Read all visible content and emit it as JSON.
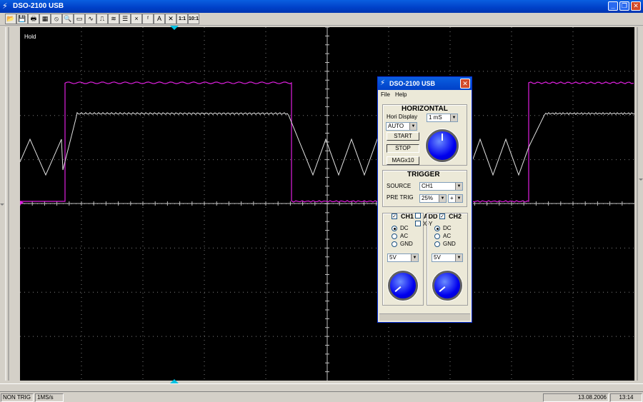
{
  "window": {
    "title": "DSO-2100 USB"
  },
  "toolbar": {
    "buttons": [
      {
        "icon": "open-folder-icon",
        "glyph": "📂"
      },
      {
        "icon": "save-icon",
        "glyph": "💾"
      },
      {
        "icon": "print-icon",
        "glyph": "🖶"
      },
      {
        "icon": "print-preview-icon",
        "glyph": "▦"
      },
      {
        "icon": "no-entry-icon",
        "glyph": "⦸"
      },
      {
        "icon": "zoom-icon",
        "glyph": "🔍"
      },
      {
        "icon": "grid-icon",
        "glyph": "▭"
      },
      {
        "icon": "wave-icon",
        "glyph": "∿"
      },
      {
        "icon": "wave-step-icon",
        "glyph": "⎍"
      },
      {
        "icon": "multi-wave-icon",
        "glyph": "≋"
      },
      {
        "icon": "lines-icon",
        "glyph": "☰"
      },
      {
        "icon": "cross-icon",
        "glyph": "×"
      },
      {
        "icon": "fft-icon",
        "glyph": "ᶠ"
      },
      {
        "icon": "cursor-a-icon",
        "glyph": "A"
      },
      {
        "icon": "close-cursor-icon",
        "glyph": "✕"
      },
      {
        "icon": "ratio-1-1-icon",
        "glyph": "1:1"
      },
      {
        "icon": "ratio-10-1-icon",
        "glyph": "10:1"
      }
    ]
  },
  "scope": {
    "hold_label": "Hold",
    "colors": {
      "ch1": "#e0e0e0",
      "ch2": "#e020e0",
      "grid": "#808080"
    }
  },
  "status": {
    "trigger": "NON TRIG",
    "rate": "1MS/s",
    "date": "13.08.2006",
    "time": "13:14"
  },
  "dialog": {
    "title": "DSO-2100 USB",
    "menu": {
      "file": "File",
      "help": "Help"
    },
    "horizontal": {
      "heading": "HORIZONTAL",
      "hori_display_label": "Hori Display",
      "time_base": "1 mS",
      "mode": "AUTO",
      "start": "START",
      "stop": "STOP",
      "mag": "MAGx10"
    },
    "trigger": {
      "heading": "TRIGGER",
      "source_label": "SOURCE",
      "source": "CH1",
      "pretrig_label": "PRE TRIG",
      "pretrig": "25%",
      "slope": "+"
    },
    "ch1": {
      "label": "CH1",
      "dc": "DC",
      "ac": "AC",
      "gnd": "GND",
      "volts": "5V"
    },
    "add": {
      "label": "ADD",
      "xy_label": "X-Y"
    },
    "ch2": {
      "label": "CH2",
      "dc": "DC",
      "ac": "AC",
      "gnd": "GND",
      "volts": "5V"
    }
  }
}
